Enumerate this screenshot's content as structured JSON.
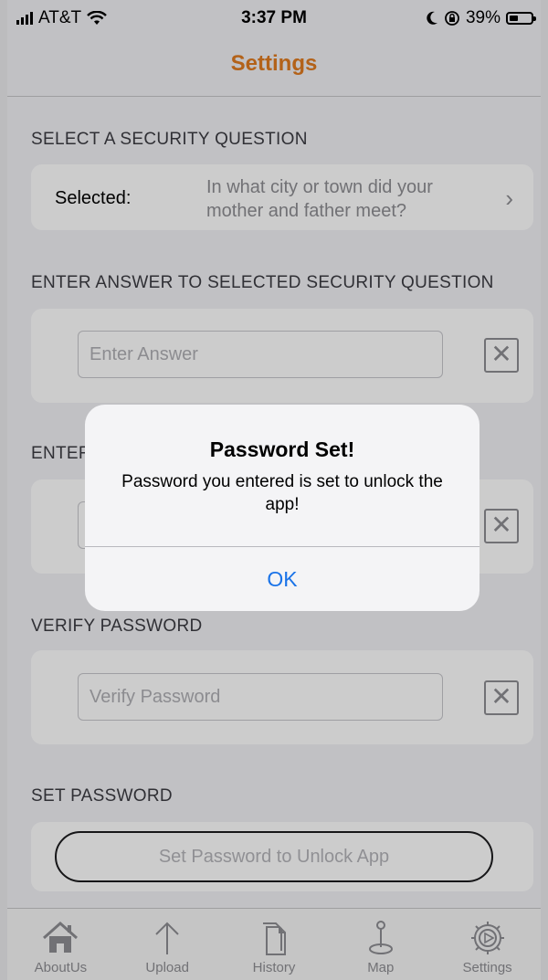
{
  "status_bar": {
    "carrier": "AT&T",
    "time": "3:37 PM",
    "battery": "39%"
  },
  "nav": {
    "title": "Settings"
  },
  "security_question": {
    "header": "SELECT A SECURITY QUESTION",
    "selected_label": "Selected:",
    "selected_value": "In what city or town did your mother and father meet?"
  },
  "answer": {
    "header": "ENTER ANSWER TO SELECTED SECURITY QUESTION",
    "placeholder": "Enter Answer"
  },
  "enter_password": {
    "header_partial": "ENTEF"
  },
  "verify_password": {
    "header": "VERIFY PASSWORD",
    "placeholder": "Verify Password"
  },
  "set_password": {
    "header": "SET PASSWORD",
    "button_label": "Set Password to Unlock App"
  },
  "clear_symbol": "✕",
  "tabs": [
    {
      "label": "AboutUs",
      "icon": "home-icon"
    },
    {
      "label": "Upload",
      "icon": "upload-arrow-icon"
    },
    {
      "label": "History",
      "icon": "document-icon"
    },
    {
      "label": "Map",
      "icon": "map-pin-icon"
    },
    {
      "label": "Settings",
      "icon": "gear-icon"
    }
  ],
  "alert": {
    "title": "Password Set!",
    "message": "Password you entered is set to unlock the app!",
    "ok_label": "OK"
  },
  "colors": {
    "accent_orange": "#e07b20",
    "link_blue": "#1a73e8"
  }
}
